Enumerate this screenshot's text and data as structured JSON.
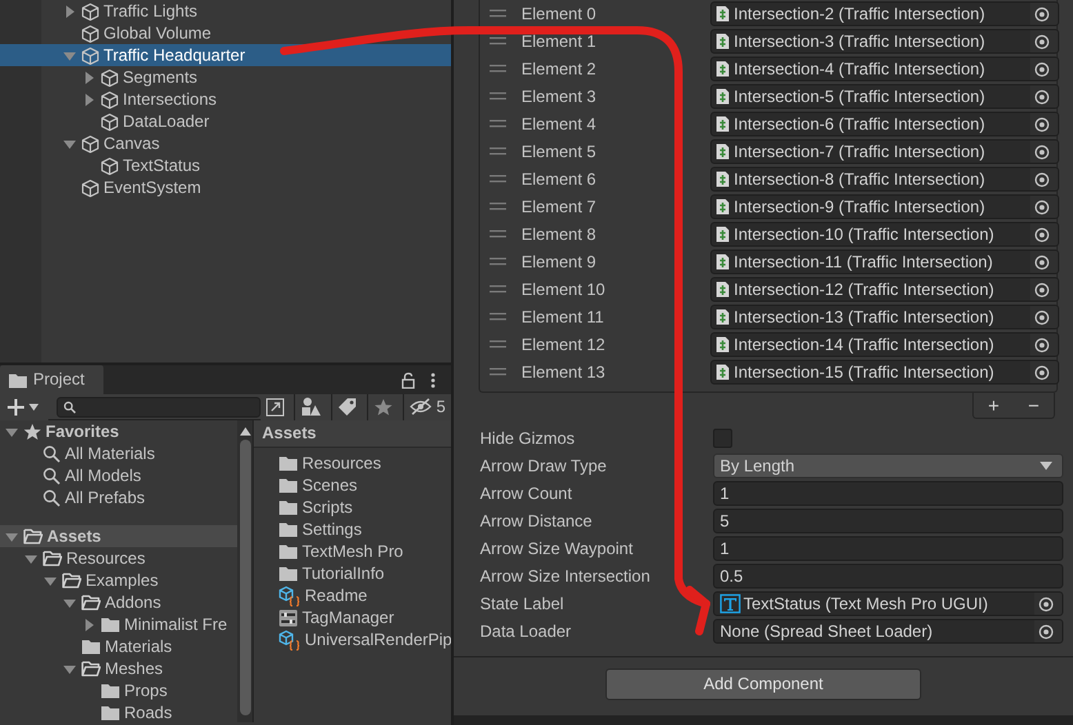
{
  "hierarchy": {
    "items": [
      {
        "label": "Traffic Lights",
        "expanded": false,
        "selected": false
      },
      {
        "label": "Global Volume",
        "selected": false
      },
      {
        "label": "Traffic Headquarter",
        "expanded": true,
        "selected": true,
        "children": [
          {
            "label": "Segments",
            "expanded": false,
            "selected": false
          },
          {
            "label": "Intersections",
            "expanded": false,
            "selected": false
          },
          {
            "label": "DataLoader",
            "selected": false
          }
        ]
      },
      {
        "label": "Canvas",
        "expanded": true,
        "selected": false,
        "children": [
          {
            "label": "TextStatus",
            "selected": false
          }
        ]
      },
      {
        "label": "EventSystem",
        "selected": false
      }
    ]
  },
  "project": {
    "tab": {
      "label": "Project",
      "selected": true
    },
    "hidden_count": "5",
    "tree": [
      {
        "label": "Favorites",
        "kind": "favorites",
        "expanded": true,
        "selected": false,
        "children": [
          {
            "label": "All Materials",
            "kind": "search",
            "selected": false
          },
          {
            "label": "All Models",
            "kind": "search",
            "selected": false
          },
          {
            "label": "All Prefabs",
            "kind": "search",
            "selected": false
          }
        ]
      },
      {
        "label": "Assets",
        "kind": "folder",
        "expanded": true,
        "selected": true,
        "children": [
          {
            "label": "Resources",
            "kind": "folder",
            "expanded": true,
            "selected": false,
            "children": [
              {
                "label": "Examples",
                "kind": "folder",
                "expanded": true,
                "selected": false,
                "children": [
                  {
                    "label": "Addons",
                    "kind": "folder",
                    "expanded": true,
                    "selected": false,
                    "children": [
                      {
                        "label": "Minimalist Fre",
                        "kind": "folder",
                        "expanded": false,
                        "selected": false
                      }
                    ]
                  },
                  {
                    "label": "Materials",
                    "kind": "folder",
                    "selected": false
                  },
                  {
                    "label": "Meshes",
                    "kind": "folder",
                    "expanded": true,
                    "selected": false,
                    "children": [
                      {
                        "label": "Props",
                        "kind": "folder",
                        "selected": false
                      },
                      {
                        "label": "Roads",
                        "kind": "folder",
                        "selected": false
                      }
                    ]
                  }
                ]
              }
            ]
          }
        ]
      }
    ],
    "breadcrumb": "Assets",
    "assets": [
      {
        "label": "Resources",
        "kind": "folder"
      },
      {
        "label": "Scenes",
        "kind": "folder"
      },
      {
        "label": "Scripts",
        "kind": "folder"
      },
      {
        "label": "Settings",
        "kind": "folder"
      },
      {
        "label": "TextMesh Pro",
        "kind": "folder"
      },
      {
        "label": "TutorialInfo",
        "kind": "folder"
      },
      {
        "label": "Readme",
        "kind": "asset"
      },
      {
        "label": "TagManager",
        "kind": "settings"
      },
      {
        "label": "UniversalRenderPip",
        "kind": "asset"
      }
    ]
  },
  "inspector": {
    "list": {
      "elements": [
        {
          "label": "Element 0",
          "value": "Intersection-2 (Traffic Intersection)"
        },
        {
          "label": "Element 1",
          "value": "Intersection-3 (Traffic Intersection)"
        },
        {
          "label": "Element 2",
          "value": "Intersection-4 (Traffic Intersection)"
        },
        {
          "label": "Element 3",
          "value": "Intersection-5 (Traffic Intersection)"
        },
        {
          "label": "Element 4",
          "value": "Intersection-6 (Traffic Intersection)"
        },
        {
          "label": "Element 5",
          "value": "Intersection-7 (Traffic Intersection)"
        },
        {
          "label": "Element 6",
          "value": "Intersection-8 (Traffic Intersection)"
        },
        {
          "label": "Element 7",
          "value": "Intersection-9 (Traffic Intersection)"
        },
        {
          "label": "Element 8",
          "value": "Intersection-10 (Traffic Intersection)"
        },
        {
          "label": "Element 9",
          "value": "Intersection-11 (Traffic Intersection)"
        },
        {
          "label": "Element 10",
          "value": "Intersection-12 (Traffic Intersection)"
        },
        {
          "label": "Element 11",
          "value": "Intersection-13 (Traffic Intersection)"
        },
        {
          "label": "Element 12",
          "value": "Intersection-14 (Traffic Intersection)"
        },
        {
          "label": "Element 13",
          "value": "Intersection-15 (Traffic Intersection)"
        }
      ],
      "add": "+",
      "remove": "−"
    },
    "properties": [
      {
        "kind": "checkbox",
        "label": "Hide Gizmos",
        "checked": false
      },
      {
        "kind": "dropdown",
        "label": "Arrow Draw Type",
        "value": "By Length"
      },
      {
        "kind": "number",
        "label": "Arrow Count",
        "value": "1"
      },
      {
        "kind": "number",
        "label": "Arrow Distance",
        "value": "5"
      },
      {
        "kind": "number",
        "label": "Arrow Size Waypoint",
        "value": "1"
      },
      {
        "kind": "number",
        "label": "Arrow Size Intersection",
        "value": "0.5"
      },
      {
        "kind": "text_object",
        "label": "State Label",
        "value": "TextStatus (Text Mesh Pro UGUI)"
      },
      {
        "kind": "object",
        "label": "Data Loader",
        "value": "None (Spread Sheet Loader)"
      }
    ],
    "add_component": "Add Component"
  }
}
